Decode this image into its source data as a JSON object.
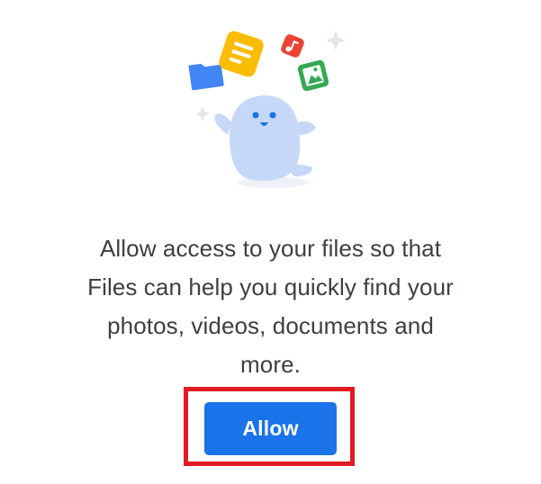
{
  "illustration": {
    "icons": [
      "folder-icon",
      "document-icon",
      "music-icon",
      "image-icon",
      "sparkle-icon",
      "mascot"
    ],
    "colors": {
      "folder": "#4285f4",
      "document": "#fbbc04",
      "music": "#ea4335",
      "image": "#34a853",
      "mascot": "#c6d8f7",
      "sparkle": "#e3e6ea"
    }
  },
  "message": {
    "lines": [
      "Allow access to your files so that",
      "Files can help you quickly find your",
      "photos, videos, documents and",
      "more."
    ]
  },
  "actions": {
    "allow_label": "Allow"
  },
  "colors": {
    "primary": "#1a73e8",
    "highlight": "#e01b24",
    "text": "#3c4043"
  }
}
